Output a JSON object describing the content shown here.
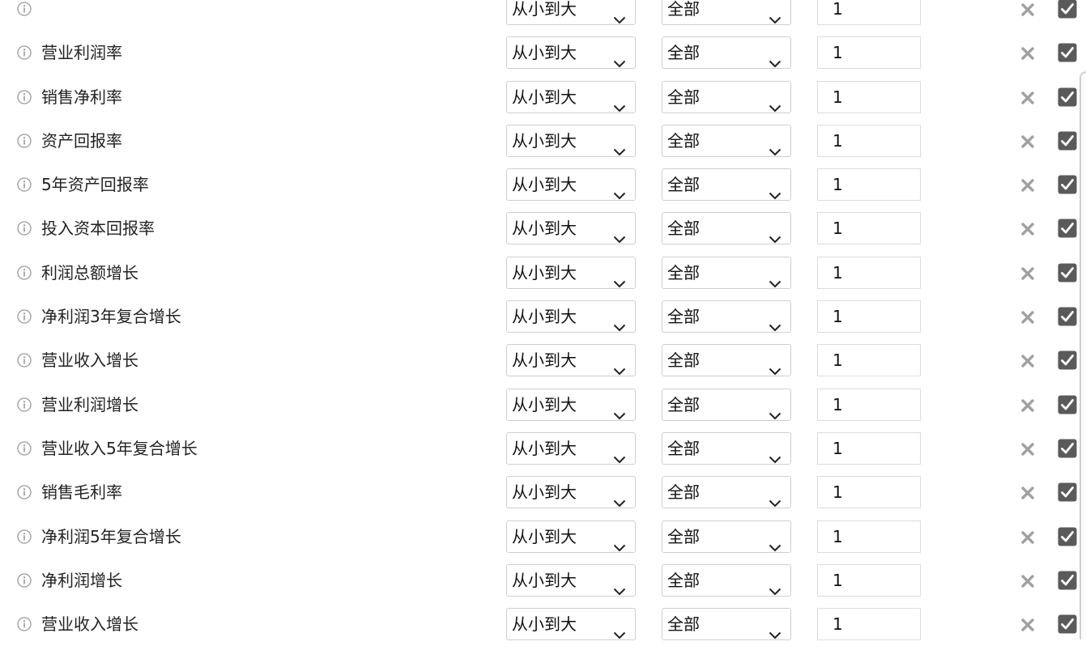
{
  "rows": [
    {
      "name": "",
      "order": "从小到大",
      "scope": "全部",
      "value": "1"
    },
    {
      "name": "营业利润率",
      "order": "从小到大",
      "scope": "全部",
      "value": "1"
    },
    {
      "name": "销售净利率",
      "order": "从小到大",
      "scope": "全部",
      "value": "1"
    },
    {
      "name": "资产回报率",
      "order": "从小到大",
      "scope": "全部",
      "value": "1"
    },
    {
      "name": "5年资产回报率",
      "order": "从小到大",
      "scope": "全部",
      "value": "1"
    },
    {
      "name": "投入资本回报率",
      "order": "从小到大",
      "scope": "全部",
      "value": "1"
    },
    {
      "name": "利润总额增长",
      "order": "从小到大",
      "scope": "全部",
      "value": "1"
    },
    {
      "name": "净利润3年复合增长",
      "order": "从小到大",
      "scope": "全部",
      "value": "1"
    },
    {
      "name": "营业收入增长",
      "order": "从小到大",
      "scope": "全部",
      "value": "1"
    },
    {
      "name": "营业利润增长",
      "order": "从小到大",
      "scope": "全部",
      "value": "1"
    },
    {
      "name": "营业收入5年复合增长",
      "order": "从小到大",
      "scope": "全部",
      "value": "1"
    },
    {
      "name": "销售毛利率",
      "order": "从小到大",
      "scope": "全部",
      "value": "1"
    },
    {
      "name": "净利润5年复合增长",
      "order": "从小到大",
      "scope": "全部",
      "value": "1"
    },
    {
      "name": "净利润增长",
      "order": "从小到大",
      "scope": "全部",
      "value": "1"
    },
    {
      "name": "营业收入增长",
      "order": "从小到大",
      "scope": "全部",
      "value": "1"
    }
  ],
  "icons": {
    "info": "info-circle-icon",
    "remove": "close-x-icon",
    "checkbox": "checkbox-checked-icon",
    "dropdown": "chevron-down-icon"
  },
  "colors": {
    "icon_gray": "#9a9a9a",
    "check_bg": "#5a5a5a",
    "input_border": "#cfcfcf"
  }
}
